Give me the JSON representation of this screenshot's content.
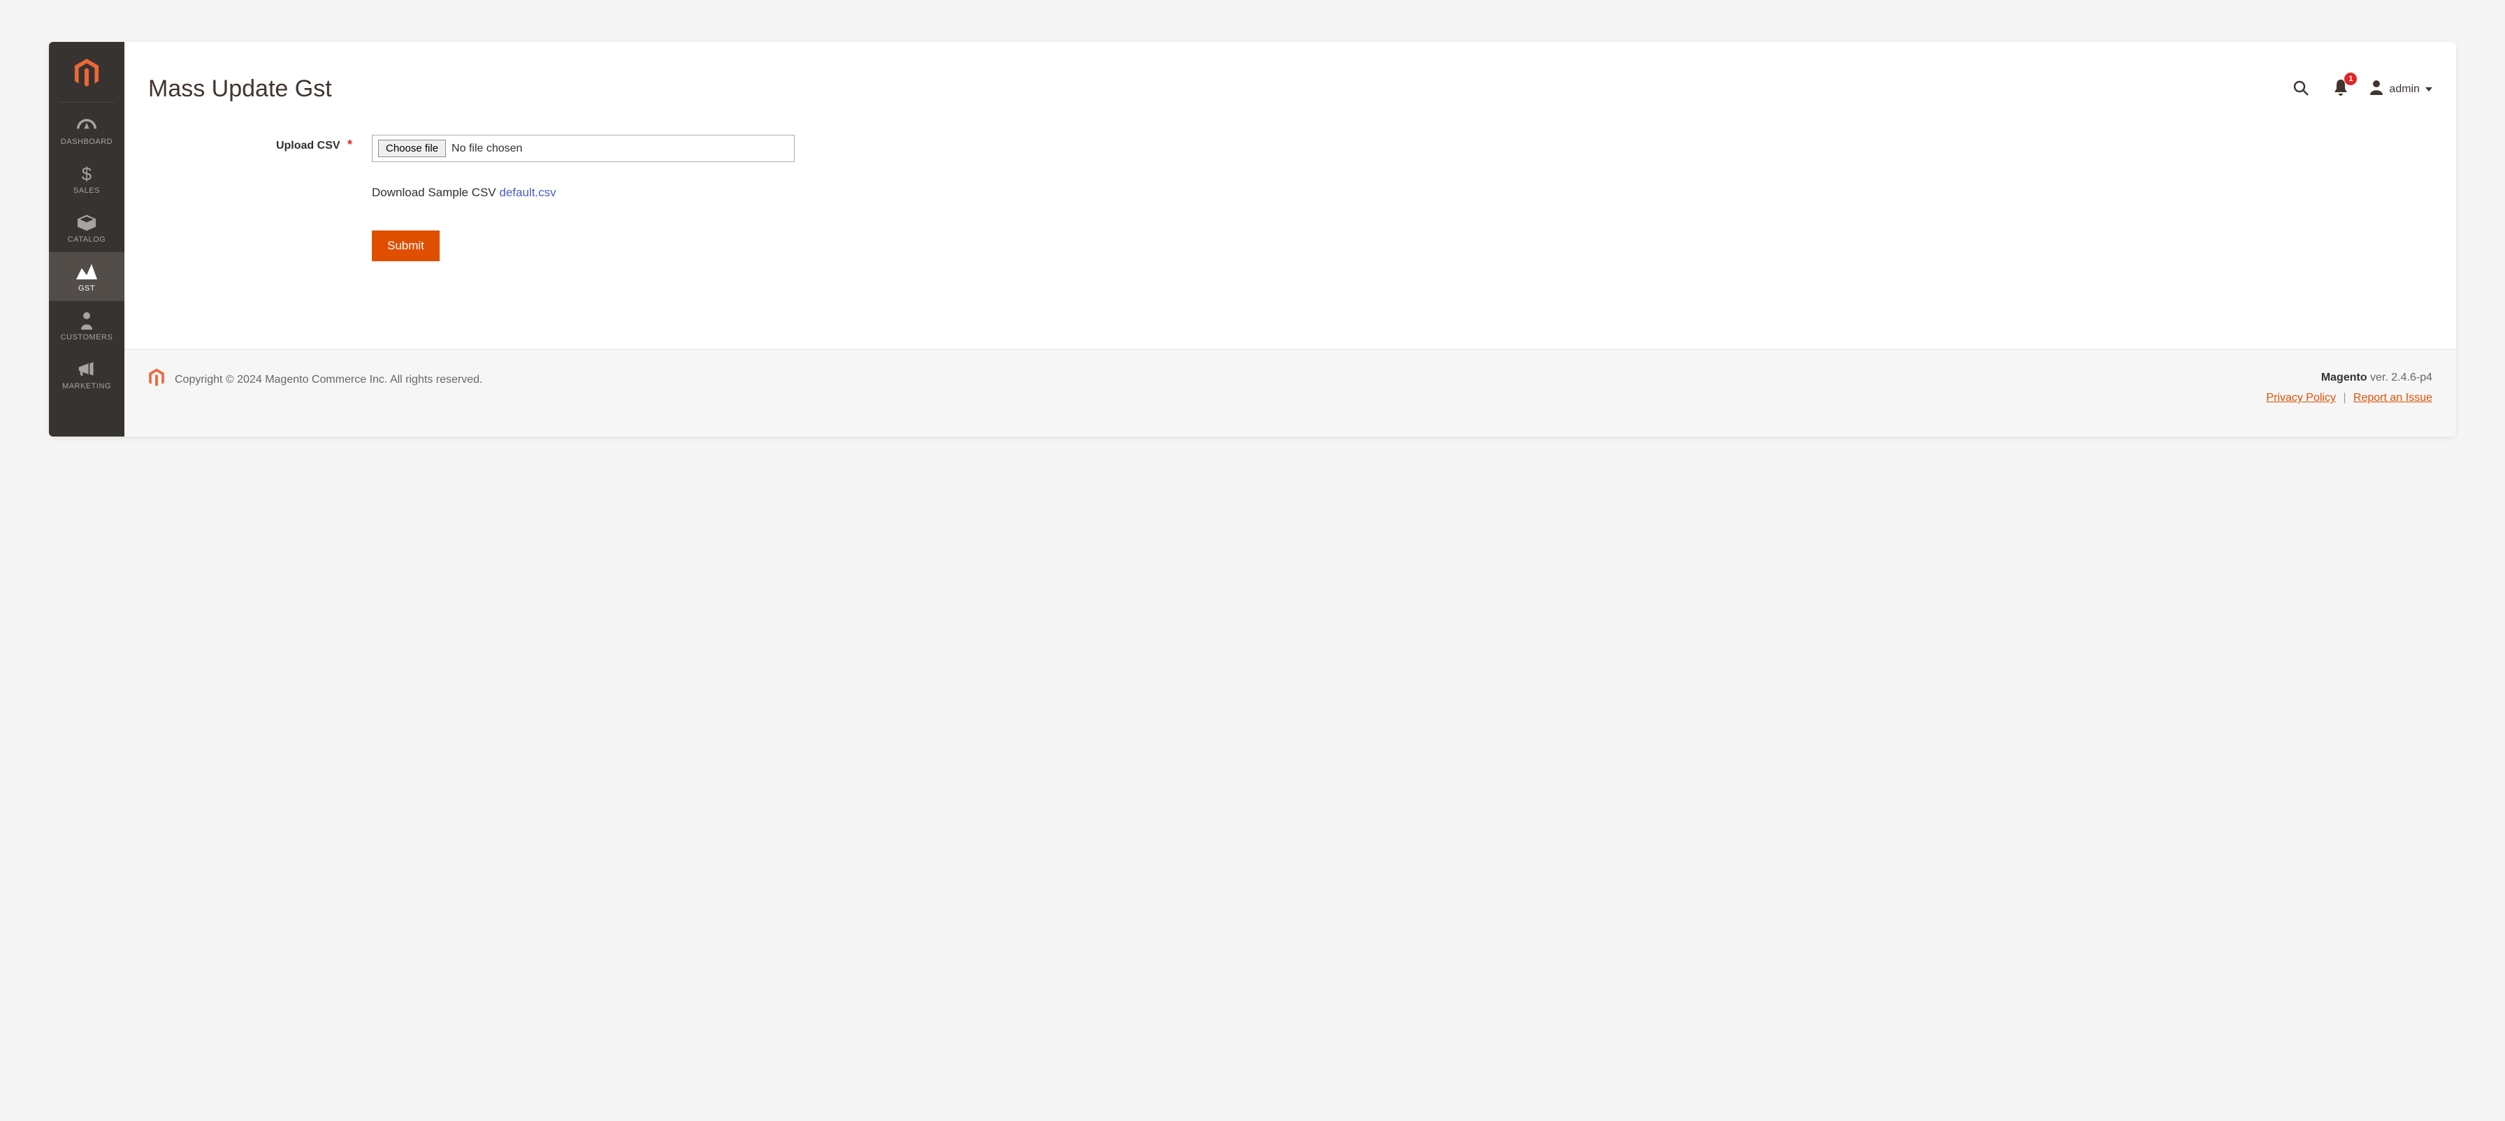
{
  "sidebar": {
    "items": [
      {
        "label": "DASHBOARD",
        "icon": "dashboard-icon",
        "active": false
      },
      {
        "label": "SALES",
        "icon": "dollar-icon",
        "active": false
      },
      {
        "label": "CATALOG",
        "icon": "box-icon",
        "active": false
      },
      {
        "label": "GST",
        "icon": "gst-icon",
        "active": true
      },
      {
        "label": "CUSTOMERS",
        "icon": "person-icon",
        "active": false
      },
      {
        "label": "MARKETING",
        "icon": "megaphone-icon",
        "active": false
      }
    ]
  },
  "header": {
    "title": "Mass Update Gst",
    "notification_count": "1",
    "user_name": "admin"
  },
  "form": {
    "upload_label": "Upload CSV",
    "choose_file_label": "Choose file",
    "file_status": "No file chosen",
    "download_text": "Download Sample CSV ",
    "download_link_text": "default.csv",
    "submit_label": "Submit"
  },
  "footer": {
    "copyright": "Copyright © 2024 Magento Commerce Inc. All rights reserved.",
    "product": "Magento",
    "version_prefix": " ver. ",
    "version": "2.4.6-p4",
    "privacy_link": "Privacy Policy",
    "report_link": "Report an Issue"
  }
}
